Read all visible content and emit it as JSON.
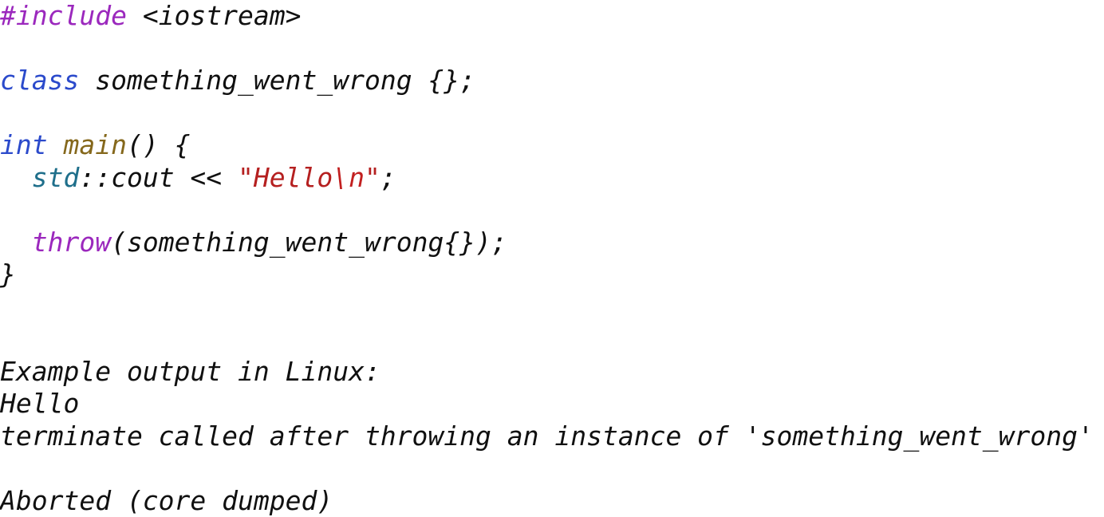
{
  "document": {
    "kind": "code-listing",
    "language": "cpp",
    "background_color": "#ffffff",
    "font_style": "italic-monospace"
  },
  "palette": {
    "plain": "#101010",
    "preprocessor": "#9b28bd",
    "keyword": "#2b4acb",
    "function": "#85681c",
    "namespace": "#1f6f8b",
    "string": "#b52020",
    "escape": "#c22020"
  },
  "lines": [
    {
      "id": "line-1",
      "text": "#include <iostream>",
      "tokens": [
        {
          "text": "#include",
          "kind": "preproc"
        },
        {
          "text": " <iostream>",
          "kind": "plain"
        }
      ]
    },
    {
      "id": "line-2",
      "text": "",
      "tokens": [
        {
          "text": " ",
          "kind": "plain"
        }
      ]
    },
    {
      "id": "line-3",
      "text": "class something_went_wrong {};",
      "tokens": [
        {
          "text": "class",
          "kind": "keyword"
        },
        {
          "text": " something_went_wrong {};",
          "kind": "plain"
        }
      ]
    },
    {
      "id": "line-4",
      "text": "",
      "tokens": [
        {
          "text": " ",
          "kind": "plain"
        }
      ]
    },
    {
      "id": "line-5",
      "text": "int main() {",
      "tokens": [
        {
          "text": "int",
          "kind": "keyword"
        },
        {
          "text": " ",
          "kind": "plain"
        },
        {
          "text": "main",
          "kind": "func"
        },
        {
          "text": "() {",
          "kind": "plain"
        }
      ]
    },
    {
      "id": "line-6",
      "text": "  std::cout << \"Hello\\n\";",
      "tokens": [
        {
          "text": "  ",
          "kind": "plain"
        },
        {
          "text": "std",
          "kind": "namespace"
        },
        {
          "text": "::cout << ",
          "kind": "plain"
        },
        {
          "text": "\"Hello",
          "kind": "string"
        },
        {
          "text": "\\n",
          "kind": "escape"
        },
        {
          "text": "\"",
          "kind": "string"
        },
        {
          "text": ";",
          "kind": "plain"
        }
      ]
    },
    {
      "id": "line-7",
      "text": "",
      "tokens": [
        {
          "text": " ",
          "kind": "plain"
        }
      ]
    },
    {
      "id": "line-8",
      "text": "  throw(something_went_wrong{});",
      "tokens": [
        {
          "text": "  ",
          "kind": "plain"
        },
        {
          "text": "throw",
          "kind": "preproc"
        },
        {
          "text": "(something_went_wrong{});",
          "kind": "plain"
        }
      ]
    },
    {
      "id": "line-9",
      "text": "}",
      "tokens": [
        {
          "text": "}",
          "kind": "plain"
        }
      ]
    },
    {
      "id": "line-10",
      "text": "",
      "tokens": [
        {
          "text": " ",
          "kind": "plain"
        }
      ]
    },
    {
      "id": "line-11",
      "text": "",
      "tokens": [
        {
          "text": " ",
          "kind": "plain"
        }
      ]
    },
    {
      "id": "line-12",
      "text": "Example output in Linux:",
      "tokens": [
        {
          "text": "Example output in Linux:",
          "kind": "output"
        }
      ]
    },
    {
      "id": "line-13",
      "text": "Hello",
      "tokens": [
        {
          "text": "Hello",
          "kind": "output"
        }
      ]
    },
    {
      "id": "line-14",
      "text": "terminate called after throwing an instance of 'something_went_wrong'",
      "tokens": [
        {
          "text": "terminate called after throwing an instance of 'something_went_wrong'",
          "kind": "output"
        }
      ]
    },
    {
      "id": "line-15",
      "text": "",
      "tokens": [
        {
          "text": " ",
          "kind": "plain"
        }
      ]
    },
    {
      "id": "line-16",
      "text": "Aborted (core dumped)",
      "tokens": [
        {
          "text": "Aborted (core dumped)",
          "kind": "output"
        }
      ]
    }
  ]
}
